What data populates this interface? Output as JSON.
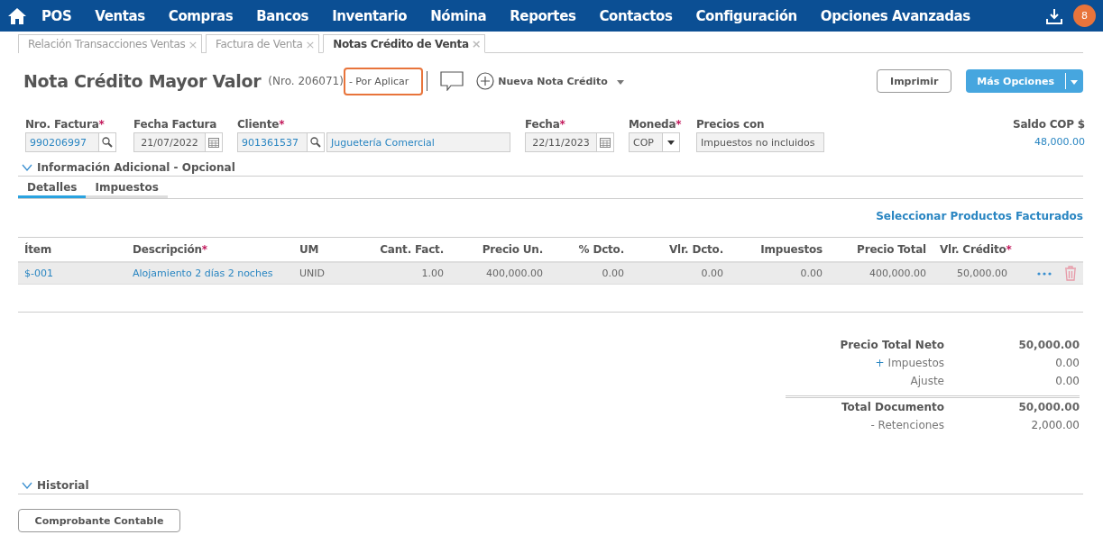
{
  "nav": {
    "items": [
      "POS",
      "Ventas",
      "Compras",
      "Bancos",
      "Inventario",
      "Nómina",
      "Reportes",
      "Contactos",
      "Configuración",
      "Opciones Avanzadas"
    ],
    "badge": "8"
  },
  "doc_tabs": [
    {
      "label": "Relación Transacciones Ventas",
      "close": "×",
      "selected": false
    },
    {
      "label": "Factura de Venta",
      "close": "×",
      "selected": false
    },
    {
      "label": "Notas Crédito de Venta",
      "close": "×",
      "selected": true
    }
  ],
  "header": {
    "title": "Nota Crédito Mayor Valor",
    "number": "(Nro. 206071)",
    "status": "- Por Aplicar",
    "new_label": "Nueva Nota Crédito",
    "print": "Imprimir",
    "more": "Más Opciones"
  },
  "fields": [
    {
      "kind": "search",
      "label": "Nro. Factura",
      "required_mark": "*",
      "value": "990206997"
    },
    {
      "kind": "date",
      "label": "Fecha Factura",
      "value": "21/07/2022"
    },
    {
      "kind": "client",
      "label": "Cliente",
      "required_mark": "*",
      "value": "901361537",
      "name": "Juguetería Comercial"
    },
    {
      "kind": "date",
      "label": "Fecha",
      "required_mark": "*",
      "value": "22/11/2023"
    },
    {
      "kind": "select",
      "label": "Moneda",
      "required_mark": "*",
      "value": "COP"
    },
    {
      "kind": "text",
      "label": "Precios con",
      "value": "Impuestos no incluidos"
    }
  ],
  "balance": {
    "label": "Saldo COP $",
    "value": "48,000.00"
  },
  "additional": {
    "label": "Información Adicional - Opcional"
  },
  "detail_tabs": [
    {
      "label": "Detalles",
      "selected": true
    },
    {
      "label": "Impuestos",
      "selected": false
    }
  ],
  "select_link": "Seleccionar Productos Facturados",
  "table": {
    "columns": [
      {
        "label": "Ítem"
      },
      {
        "label": "Descripción",
        "required_mark": "*"
      },
      {
        "label": "UM"
      },
      {
        "label": "Cant. Fact."
      },
      {
        "label": "Precio Un."
      },
      {
        "label": "% Dcto."
      },
      {
        "label": "Vlr. Dcto."
      },
      {
        "label": "Impuestos"
      },
      {
        "label": "Precio Total"
      },
      {
        "label": "Vlr. Crédito",
        "required_mark": "*"
      }
    ],
    "rows": [
      [
        "$-001",
        "Alojamiento 2 días 2 noches",
        "UNID",
        "1.00",
        "400,000.00",
        "0.00",
        "0.00",
        "0.00",
        "400,000.00",
        "50,000.00"
      ]
    ]
  },
  "totals": [
    {
      "kind": "strong",
      "label": "Precio Total Neto",
      "value": "50,000.00"
    },
    {
      "kind": "plain",
      "sign": "+",
      "label": "Impuestos",
      "value": "0.00"
    },
    {
      "kind": "plain",
      "label": "Ajuste",
      "value": "0.00"
    },
    {
      "kind": "strong",
      "label": "Total Documento",
      "value": "50,000.00"
    },
    {
      "kind": "plain",
      "label": "- Retenciones",
      "value": "2,000.00"
    }
  ],
  "history": {
    "label": "Historial"
  },
  "voucher_button": "Comprobante Contable"
}
